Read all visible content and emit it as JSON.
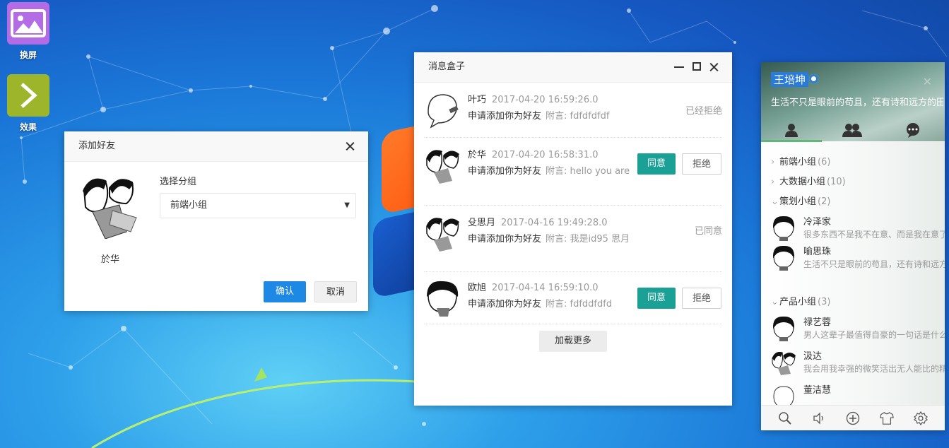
{
  "desktop": {
    "icons": [
      {
        "label": "换屏",
        "color": "#b46ce6"
      },
      {
        "label": "效果",
        "color": "#9db52a"
      }
    ]
  },
  "add_friend": {
    "title": "添加好友",
    "friend_name": "於华",
    "group_label": "选择分组",
    "selected_group": "前端小组",
    "confirm_label": "确认",
    "cancel_label": "取消"
  },
  "message_box": {
    "title": "消息盒子",
    "messages": [
      {
        "name": "叶巧",
        "time": "2017-04-20 16:59:26.0",
        "text": "申请添加你为好友",
        "note": "附言: fdfdfdfdf",
        "status": "已经拒绝"
      },
      {
        "name": "於华",
        "time": "2017-04-20 16:58:31.0",
        "text": "申请添加你为好友",
        "note": "附言: hello you are",
        "agree": "同意",
        "reject": "拒绝"
      },
      {
        "name": "殳思月",
        "time": "2017-04-16 19:49:28.0",
        "text": "申请添加你为好友",
        "note": "附言: 我是id95 思月",
        "status": "已同意"
      },
      {
        "name": "欧旭",
        "time": "2017-04-14 16:59:10.0",
        "text": "申请添加你为好友",
        "note": "附言: fdfddfdfd",
        "agree": "同意",
        "reject": "拒绝"
      }
    ],
    "load_more": "加载更多"
  },
  "chat_panel": {
    "username": "王培坤",
    "signature": "生活不只是眼前的苟且，还有诗和远方的田野",
    "groups": [
      {
        "name": "前端小组",
        "count": "(6)",
        "open": false
      },
      {
        "name": "大数据小组",
        "count": "(10)",
        "open": false
      },
      {
        "name": "策划小组",
        "count": "(2)",
        "open": true
      },
      {
        "name": "产品小组",
        "count": "(3)",
        "open": true
      }
    ],
    "friends": [
      {
        "name": "冷泽家",
        "sign": "很多东西不是我不在意、而是我在意了又能怎样"
      },
      {
        "name": "喻思珠",
        "sign": "生活不只是眼前的苟且，还有诗和远方的田野"
      },
      {
        "name": "禄艺蓉",
        "sign": "男人这辈子最值得自豪的一句话是什么"
      },
      {
        "name": "汲达",
        "sign": "我会用我幸强的微笑活出无人能比的精彩"
      },
      {
        "name": "董洁慧",
        "sign": ""
      }
    ]
  }
}
